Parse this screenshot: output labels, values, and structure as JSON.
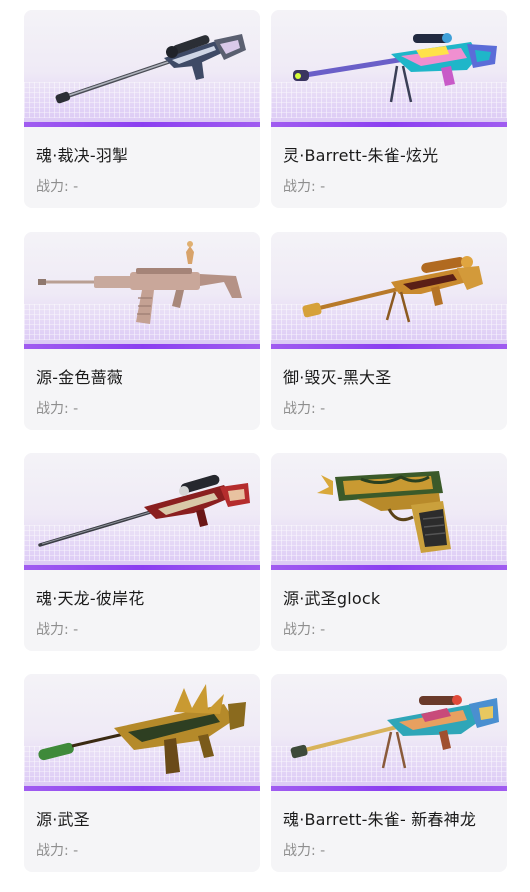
{
  "cards": [
    {
      "name": "魂·裁决-羽掣",
      "power_label": "战力:",
      "power_value": "-",
      "icon": "sniper-rifle-icon"
    },
    {
      "name": "灵·Barrett-朱雀-炫光",
      "power_label": "战力:",
      "power_value": "-",
      "icon": "barrett-rifle-icon"
    },
    {
      "name": "源-金色蔷薇",
      "power_label": "战力:",
      "power_value": "-",
      "icon": "assault-rifle-icon"
    },
    {
      "name": "御·毁灭-黑大圣",
      "power_label": "战力:",
      "power_value": "-",
      "icon": "golden-sniper-icon"
    },
    {
      "name": "魂·天龙-彼岸花",
      "power_label": "战力:",
      "power_value": "-",
      "icon": "dragon-sniper-icon"
    },
    {
      "name": "源·武圣glock",
      "power_label": "战力:",
      "power_value": "-",
      "icon": "pistol-icon"
    },
    {
      "name": "源·武圣",
      "power_label": "战力:",
      "power_value": "-",
      "icon": "dragon-rifle-icon"
    },
    {
      "name": "魂·Barrett-朱雀- 新春神龙",
      "power_label": "战力:",
      "power_value": "-",
      "icon": "barrett-dragon-icon"
    }
  ],
  "colors": {
    "card_bg": "#f5f5f7",
    "accent_purple": "#8b3ff0",
    "name_text": "#1a1a1a",
    "power_text": "#8e8e8e"
  }
}
